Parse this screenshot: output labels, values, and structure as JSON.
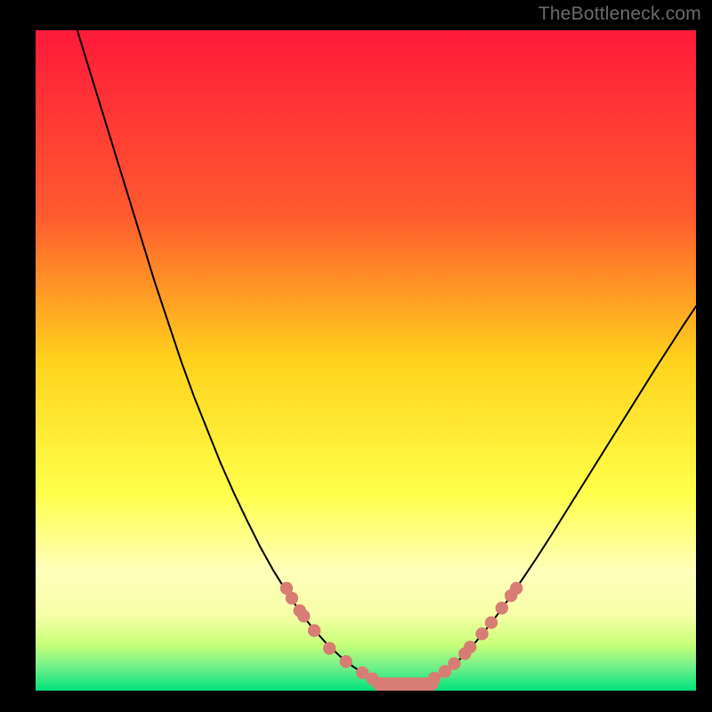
{
  "watermark": "TheBottleneck.com",
  "colors": {
    "bg": "#000000",
    "gradient_top": "#ff1a3a",
    "gradient_mid1": "#ff7a2a",
    "gradient_mid2": "#ffd21c",
    "gradient_mid3": "#ffff66",
    "gradient_mid4": "#d9ff66",
    "gradient_bottom": "#00e27a",
    "curve": "#000000",
    "dot_fill": "#d77d73",
    "dot_stroke": "#c86a60"
  },
  "chart_data": {
    "type": "line",
    "title": "",
    "xlabel": "",
    "ylabel": "",
    "xlim": [
      0,
      100
    ],
    "ylim": [
      0,
      100
    ],
    "x": [
      0,
      2,
      4,
      6,
      8,
      10,
      12,
      14,
      16,
      18,
      20,
      22,
      24,
      26,
      28,
      30,
      32,
      34,
      36,
      38,
      40,
      42,
      44,
      46,
      48,
      50,
      52,
      54,
      56,
      58,
      60,
      62,
      64,
      66,
      68,
      70,
      72,
      74,
      76,
      78,
      80,
      82,
      84,
      86,
      88,
      90,
      92,
      94,
      96,
      98,
      100
    ],
    "values": [
      119,
      114,
      108,
      101,
      94.5,
      88,
      81.5,
      75,
      68.5,
      62,
      56,
      50,
      44.5,
      39.5,
      34.5,
      30,
      25.8,
      21.8,
      18.2,
      15,
      12,
      9.4,
      7.2,
      5.3,
      3.7,
      2.4,
      1.5,
      1,
      1,
      1,
      1.6,
      2.8,
      4.5,
      6.6,
      9,
      11.6,
      14.4,
      17.3,
      20.3,
      23.4,
      26.6,
      29.8,
      33,
      36.2,
      39.4,
      42.6,
      45.8,
      49,
      52.1,
      55.2,
      58.2
    ],
    "flat_segment": {
      "x_start": 52,
      "x_end": 60,
      "y": 1
    },
    "dots": [
      {
        "x": 38.0,
        "y": 15.5
      },
      {
        "x": 38.8,
        "y": 14.0
      },
      {
        "x": 40.0,
        "y": 12.1
      },
      {
        "x": 40.6,
        "y": 11.3
      },
      {
        "x": 42.2,
        "y": 9.1
      },
      {
        "x": 44.5,
        "y": 6.4
      },
      {
        "x": 47.0,
        "y": 4.4
      },
      {
        "x": 49.5,
        "y": 2.7
      },
      {
        "x": 51.0,
        "y": 1.8
      },
      {
        "x": 60.4,
        "y": 1.9
      },
      {
        "x": 62.0,
        "y": 2.9
      },
      {
        "x": 63.4,
        "y": 4.1
      },
      {
        "x": 65.0,
        "y": 5.6
      },
      {
        "x": 65.8,
        "y": 6.6
      },
      {
        "x": 67.6,
        "y": 8.6
      },
      {
        "x": 69.0,
        "y": 10.3
      },
      {
        "x": 70.6,
        "y": 12.5
      },
      {
        "x": 72.0,
        "y": 14.4
      },
      {
        "x": 72.8,
        "y": 15.5
      }
    ]
  }
}
